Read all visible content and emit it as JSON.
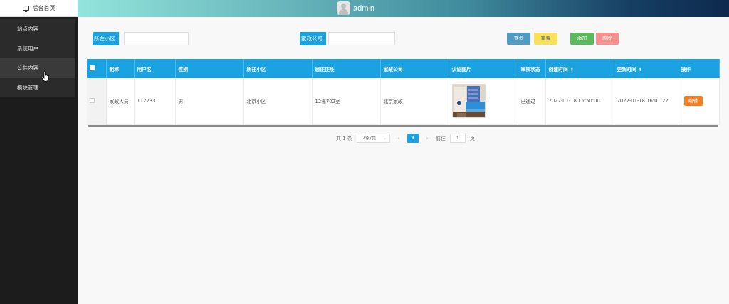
{
  "sidebar": {
    "home_label": "后台首页",
    "items": [
      {
        "label": "站点内容"
      },
      {
        "label": "系统用户"
      },
      {
        "label": "公共内容"
      },
      {
        "label": "模块管理"
      }
    ]
  },
  "header": {
    "username": "admin"
  },
  "search": {
    "community_label": "所在小区:",
    "community_value": "",
    "company_label": "家政公司:",
    "company_value": ""
  },
  "buttons": {
    "query": "查询",
    "reset": "重置",
    "add": "添加",
    "delete": "删除"
  },
  "colors": {
    "primary": "#1aa3e0",
    "query_btn": "#4f9bc1",
    "reset_btn": "#f7e15a",
    "add_btn": "#5cb85c",
    "delete_btn": "#f98f8f",
    "edit_btn": "#f57c1f"
  },
  "table": {
    "headers": [
      "昵称",
      "用户名",
      "性别",
      "所在小区",
      "居住住址",
      "家政公司",
      "认证图片",
      "审核状态",
      "创建时间",
      "更新时间",
      "操作"
    ],
    "rows": [
      {
        "nickname": "家政人员",
        "username": "112233",
        "gender": "男",
        "community": "北京小区",
        "address": "12栋702室",
        "company": "北京家政",
        "status": "已通过",
        "created": "2022-01-18 15:50:00",
        "updated": "2022-01-18 16:01:22",
        "action": "编辑"
      }
    ]
  },
  "pagination": {
    "total": "共 1 条",
    "page_size": "7条/页",
    "current_page": "1",
    "goto_label": "前往",
    "goto_value": "1",
    "page_unit": "页"
  }
}
